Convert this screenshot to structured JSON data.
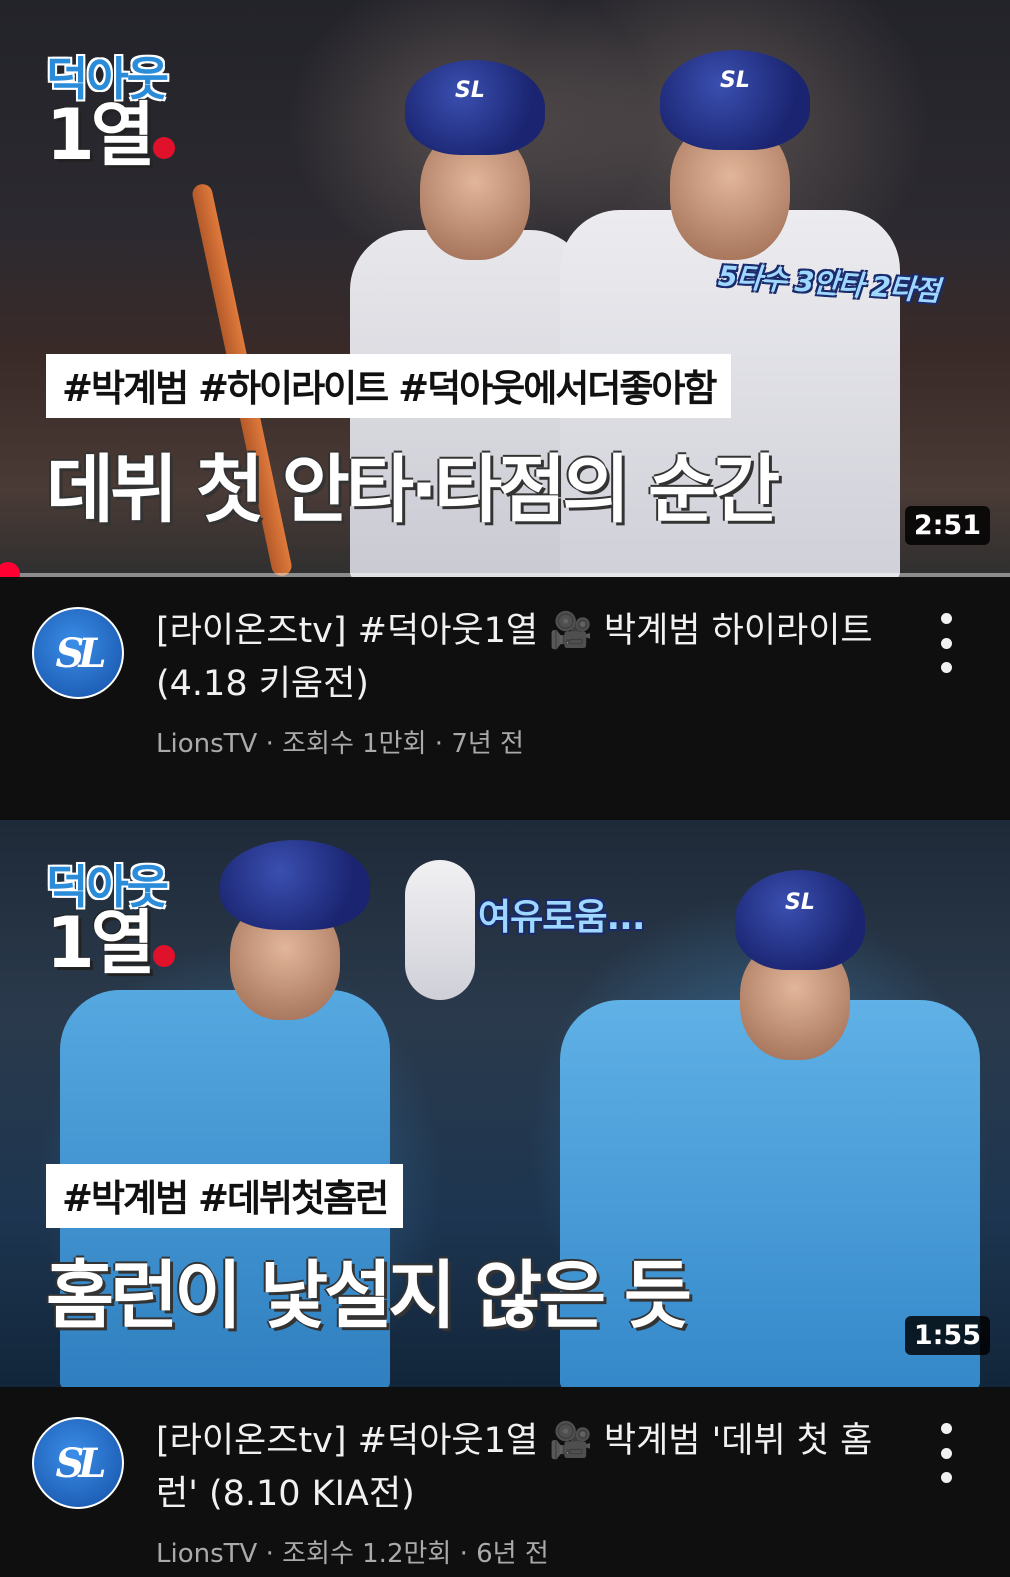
{
  "videos": [
    {
      "badge_top": "덕아웃",
      "badge_bottom": "1열",
      "tags": "#박계범 #하이라이트 #덕아웃에서더좋아함",
      "headline": "데뷔 첫 안타·타점의 순간",
      "caption": "5타수 3안타 2타점",
      "duration": "2:51",
      "progress": 0,
      "channel_logo": "SL",
      "title": "[라이온즈tv] #덕아웃1열 🎥 박계범 하이라이트 (4.18 키움전)",
      "channel": "LionsTV",
      "views": "조회수 1만회",
      "age": "7년 전"
    },
    {
      "badge_top": "덕아웃",
      "badge_bottom": "1열",
      "tags": "#박계범 #데뷔첫홈런",
      "headline": "홈런이 낯설지 않은 듯",
      "caption": "여유로움...",
      "duration": "1:55",
      "channel_logo": "SL",
      "title": "[라이온즈tv] #덕아웃1열 🎥 박계범 '데뷔 첫 홈런' (8.10 KIA전)",
      "channel": "LionsTV",
      "views": "조회수 1.2만회",
      "age": "6년 전"
    }
  ],
  "separator": " · ",
  "icons": {
    "more": "more-vertical-icon",
    "progress": "progress-scrubber"
  },
  "colors": {
    "background": "#0f0f0f",
    "progress": "#ff0033",
    "badge_blue": "#2a8bd9"
  }
}
